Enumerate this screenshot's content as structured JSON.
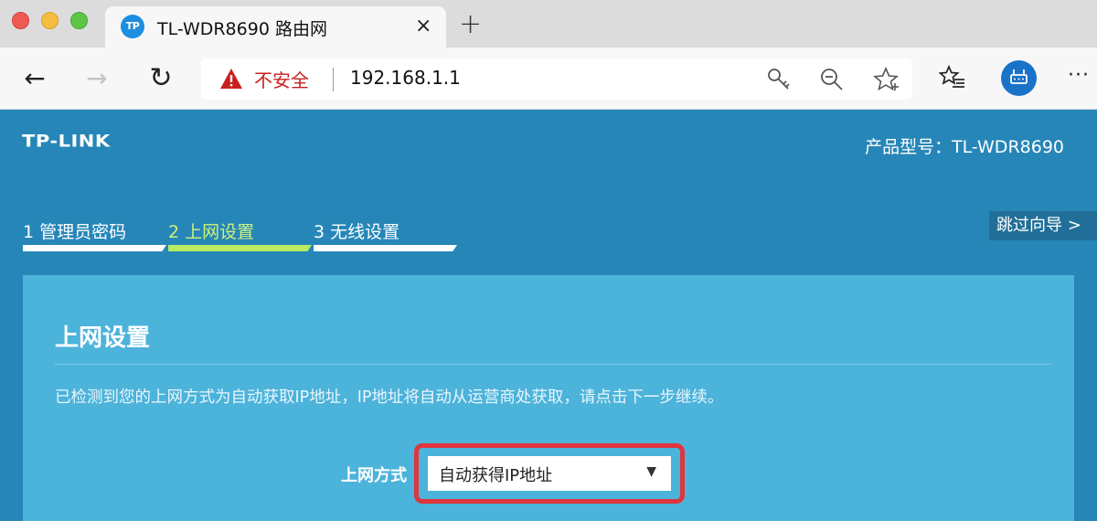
{
  "browser": {
    "tab": {
      "favicon_text": "TP",
      "title": "TL-WDR8690 路由网",
      "close": "×"
    },
    "new_tab": "+",
    "nav": {
      "back": "←",
      "forward": "→",
      "reload": "↻"
    },
    "address_bar": {
      "security_label": "不安全",
      "url": "192.168.1.1"
    },
    "more": "···"
  },
  "router": {
    "logo": "TP-LINK",
    "model_label": "产品型号：TL-WDR8690",
    "steps": [
      {
        "label": "1 管理员密码",
        "state": "done"
      },
      {
        "label": "2 上网设置",
        "state": "active"
      },
      {
        "label": "3 无线设置",
        "state": "pending"
      }
    ],
    "skip_wizard": "跳过向导 >",
    "panel": {
      "title": "上网设置",
      "description": "已检测到您的上网方式为自动获取IP地址，IP地址将自动从运营商处获取，请点击下一步继续。",
      "field_label": "上网方式",
      "select_value": "自动获得IP地址"
    }
  },
  "colors": {
    "page_bg": "#2686b8",
    "panel_bg": "#4cb3db",
    "active_step": "#b9ec62",
    "highlight_border": "#e0353e",
    "insecure_red": "#c8201e"
  }
}
